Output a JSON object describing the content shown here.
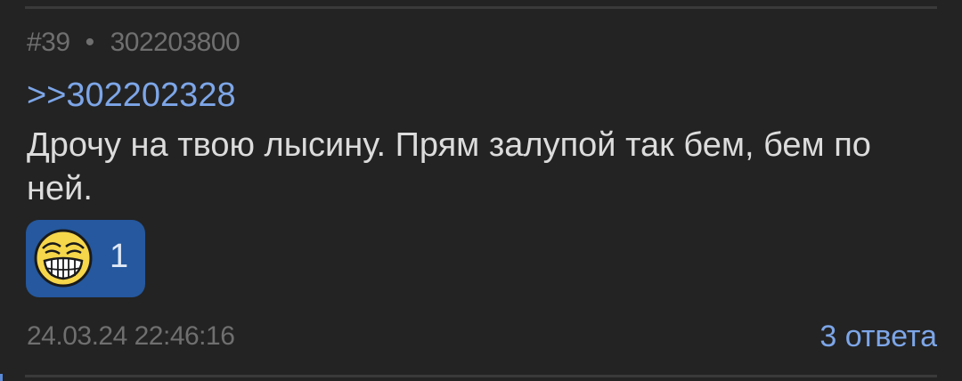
{
  "post": {
    "number": "#39",
    "separator": "•",
    "id": "302203800",
    "reply_to": ">>302202328",
    "text": "Дрочу на твою лысину. Прям залупой так бем, бем по ней.",
    "timestamp": "24.03.24 22:46:16",
    "replies_label": "3 ответа"
  },
  "reaction": {
    "icon": "laughing-face-icon",
    "count": "1"
  },
  "colors": {
    "background": "#232323",
    "link": "#7da6e8",
    "meta_text": "#6f6f6f",
    "body_text": "#dcdcdc",
    "reaction_bg": "#25589e",
    "emoji_yellow": "#f6d64a"
  }
}
